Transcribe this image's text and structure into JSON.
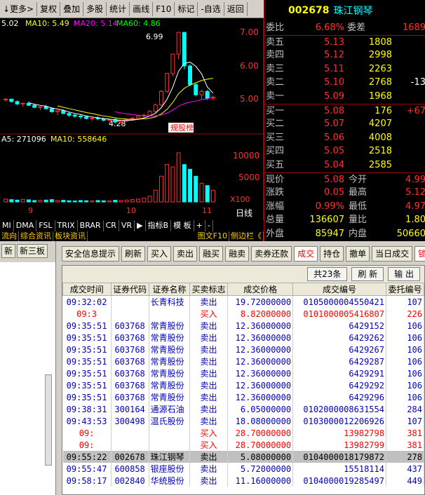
{
  "toolbar": {
    "items": [
      "↓更多>",
      "复权",
      "叠加",
      "多股",
      "统计",
      "画线",
      "F10",
      "标记",
      "-自选",
      "返回"
    ]
  },
  "quote_header": {
    "code": "002678",
    "name": "珠江钢琴"
  },
  "ma_legend": {
    "ma5": "5.02",
    "ma10": "MA10: 5.49",
    "ma20": "MA20: 5.14",
    "ma60": "MA60: 4.86"
  },
  "price_axis": [
    "7.00",
    "6.00",
    "5.00"
  ],
  "high_label": "6.99",
  "low_label": "4.28",
  "stock_tag": "规股榜",
  "vol_legend": {
    "ma5": "A5: 271096",
    "ma10": "MA10: 558646"
  },
  "vol_axis": [
    "10000",
    "5000",
    "X100"
  ],
  "date_labels": [
    "9",
    "10",
    "11"
  ],
  "period_label": "日线",
  "chart_data": {
    "type": "candlestick",
    "price_ylim": [
      4.1,
      7.2
    ],
    "ohlc": [
      [
        5.0,
        5.05,
        4.95,
        5.02
      ],
      [
        5.02,
        5.04,
        4.92,
        4.95
      ],
      [
        4.95,
        4.98,
        4.85,
        4.88
      ],
      [
        4.88,
        4.92,
        4.8,
        4.9
      ],
      [
        4.9,
        4.95,
        4.82,
        4.84
      ],
      [
        4.84,
        4.88,
        4.75,
        4.78
      ],
      [
        4.78,
        4.82,
        4.7,
        4.8
      ],
      [
        4.8,
        4.85,
        4.72,
        4.74
      ],
      [
        4.74,
        4.78,
        4.62,
        4.65
      ],
      [
        4.65,
        4.7,
        4.55,
        4.68
      ],
      [
        4.68,
        4.72,
        4.58,
        4.6
      ],
      [
        4.6,
        4.64,
        4.5,
        4.55
      ],
      [
        4.55,
        4.6,
        4.48,
        4.52
      ],
      [
        4.52,
        4.56,
        4.44,
        4.5
      ],
      [
        4.5,
        4.54,
        4.42,
        4.45
      ],
      [
        4.45,
        4.5,
        4.38,
        4.46
      ],
      [
        4.46,
        4.52,
        4.4,
        4.44
      ],
      [
        4.44,
        4.48,
        4.36,
        4.4
      ],
      [
        4.4,
        4.45,
        4.33,
        4.42
      ],
      [
        4.42,
        4.46,
        4.3,
        4.35
      ],
      [
        4.35,
        4.4,
        4.28,
        4.38
      ],
      [
        4.38,
        4.45,
        4.34,
        4.42
      ],
      [
        4.42,
        4.5,
        4.38,
        4.46
      ],
      [
        4.46,
        4.55,
        4.42,
        4.52
      ],
      [
        4.52,
        4.6,
        4.48,
        4.55
      ],
      [
        4.55,
        4.7,
        4.52,
        4.66
      ],
      [
        4.66,
        4.9,
        4.62,
        4.85
      ],
      [
        4.85,
        5.3,
        4.8,
        5.25
      ],
      [
        5.25,
        5.8,
        5.2,
        5.78
      ],
      [
        5.78,
        6.35,
        5.7,
        6.35
      ],
      [
        6.35,
        6.99,
        6.2,
        6.99
      ],
      [
        6.99,
        6.99,
        5.9,
        6.0
      ],
      [
        6.0,
        6.05,
        5.4,
        5.45
      ],
      [
        5.45,
        5.5,
        5.1,
        5.15
      ],
      [
        5.15,
        5.3,
        5.0,
        5.25
      ],
      [
        5.25,
        5.3,
        5.0,
        5.05
      ],
      [
        5.05,
        5.12,
        4.98,
        5.08
      ]
    ],
    "vol_ylim": [
      0,
      12000
    ],
    "volume": [
      600,
      500,
      400,
      550,
      450,
      300,
      350,
      400,
      500,
      300,
      350,
      250,
      200,
      300,
      250,
      200,
      300,
      250,
      200,
      350,
      300,
      400,
      500,
      600,
      800,
      1200,
      2500,
      5500,
      8000,
      7500,
      10500,
      8000,
      7000,
      5500,
      4000,
      3500,
      2500
    ]
  },
  "quote": {
    "weibi": {
      "label": "委比",
      "value": "6.68%",
      "label2": "委差",
      "value2": "1689"
    },
    "sells": [
      {
        "label": "卖五",
        "price": "5.13",
        "vol": "1808",
        "chg": ""
      },
      {
        "label": "卖四",
        "price": "5.12",
        "vol": "2998",
        "chg": ""
      },
      {
        "label": "卖三",
        "price": "5.11",
        "vol": "2263",
        "chg": ""
      },
      {
        "label": "卖二",
        "price": "5.10",
        "vol": "2768",
        "chg": "-13"
      },
      {
        "label": "卖一",
        "price": "5.09",
        "vol": "1968",
        "chg": ""
      }
    ],
    "buys": [
      {
        "label": "买一",
        "price": "5.08",
        "vol": "176",
        "chg": "+67"
      },
      {
        "label": "买二",
        "price": "5.07",
        "vol": "4207",
        "chg": ""
      },
      {
        "label": "买三",
        "price": "5.06",
        "vol": "4008",
        "chg": ""
      },
      {
        "label": "买四",
        "price": "5.05",
        "vol": "2518",
        "chg": ""
      },
      {
        "label": "买五",
        "price": "5.04",
        "vol": "2585",
        "chg": ""
      }
    ],
    "stats": [
      {
        "l1": "现价",
        "v1": "5.08",
        "l2": "今开",
        "v2": "4.99"
      },
      {
        "l1": "涨跌",
        "v1": "0.05",
        "l2": "最高",
        "v2": "5.12"
      },
      {
        "l1": "涨幅",
        "v1": "0.99%",
        "l2": "最低",
        "v2": "4.97"
      },
      {
        "l1": "总量",
        "v1": "136607",
        "l2": "量比",
        "v2": "1.80"
      },
      {
        "l1": "外盘",
        "v1": "85947",
        "l2": "内盘",
        "v2": "50660"
      }
    ]
  },
  "chart_tabs": [
    "MI",
    "DMA",
    "FSL",
    "TRIX",
    "BRAR",
    "CR",
    "VR",
    "▶",
    "指标B",
    "模 板",
    "+",
    "-"
  ],
  "info_tabs": [
    "流向",
    "综合资讯",
    "板块资讯",
    "图文F10",
    "侧边栏《"
  ],
  "left_buttons": [
    "新",
    "新三板"
  ],
  "trade_buttons": [
    "安全信息提示",
    "刷新",
    "买入",
    "卖出",
    "融买",
    "融卖",
    "卖券还款",
    "成交",
    "持仓",
    "撤单",
    "当日成交",
    "锁定"
  ],
  "grid_top": {
    "count": "共23条",
    "refresh": "刷 新",
    "export": "输 出"
  },
  "columns": [
    "成交时间",
    "证券代码",
    "证券名称",
    "买卖标志",
    "成交价格",
    "成交编号",
    "委托编号"
  ],
  "rows": [
    {
      "t": "09:32:02",
      "code": "",
      "name": "长青科技",
      "side": "卖出",
      "price": "19.72000000",
      "deal": "0105000004550421",
      "order": "107",
      "cls": "blue"
    },
    {
      "t": "09:3",
      "code": "",
      "name": "",
      "side": "买入",
      "price": "8.82000000",
      "deal": "0101000005416807",
      "order": "226",
      "cls": "redr"
    },
    {
      "t": "09:35:51",
      "code": "603768",
      "name": "常青股份",
      "side": "卖出",
      "price": "12.36000000",
      "deal": "6429152",
      "order": "106",
      "cls": "blue"
    },
    {
      "t": "09:35:51",
      "code": "603768",
      "name": "常青股份",
      "side": "卖出",
      "price": "12.36000000",
      "deal": "6429262",
      "order": "106",
      "cls": "blue"
    },
    {
      "t": "09:35:51",
      "code": "603768",
      "name": "常青股份",
      "side": "卖出",
      "price": "12.36000000",
      "deal": "6429267",
      "order": "106",
      "cls": "blue"
    },
    {
      "t": "09:35:51",
      "code": "603768",
      "name": "常青股份",
      "side": "卖出",
      "price": "12.36000000",
      "deal": "6429287",
      "order": "106",
      "cls": "blue"
    },
    {
      "t": "09:35:51",
      "code": "603768",
      "name": "常青股份",
      "side": "卖出",
      "price": "12.36000000",
      "deal": "6429291",
      "order": "106",
      "cls": "blue"
    },
    {
      "t": "09:35:51",
      "code": "603768",
      "name": "常青股份",
      "side": "卖出",
      "price": "12.36000000",
      "deal": "6429292",
      "order": "106",
      "cls": "blue"
    },
    {
      "t": "09:35:51",
      "code": "603768",
      "name": "常青股份",
      "side": "卖出",
      "price": "12.36000000",
      "deal": "6429296",
      "order": "106",
      "cls": "blue"
    },
    {
      "t": "09:38:31",
      "code": "300164",
      "name": "通源石油",
      "side": "卖出",
      "price": "6.05000000",
      "deal": "0102000008631554",
      "order": "284",
      "cls": "blue"
    },
    {
      "t": "09:43:53",
      "code": "300498",
      "name": "温氏股份",
      "side": "卖出",
      "price": "18.08000000",
      "deal": "0103000012206926",
      "order": "107",
      "cls": "blue"
    },
    {
      "t": "09:",
      "code": "",
      "name": "",
      "side": "买入",
      "price": "28.70000000",
      "deal": "13982798",
      "order": "381",
      "cls": "redr"
    },
    {
      "t": "09:",
      "code": "",
      "name": "",
      "side": "买入",
      "price": "28.70000000",
      "deal": "13982799",
      "order": "381",
      "cls": "redr"
    },
    {
      "t": "09:55:22",
      "code": "002678",
      "name": "珠江钢琴",
      "side": "卖出",
      "price": "5.08000000",
      "deal": "0104000018179872",
      "order": "278",
      "cls": "sel"
    },
    {
      "t": "09:55:47",
      "code": "600858",
      "name": "银座股份",
      "side": "卖出",
      "price": "5.72000000",
      "deal": "15518114",
      "order": "437",
      "cls": "blue"
    },
    {
      "t": "09:58:17",
      "code": "002840",
      "name": "华统股份",
      "side": "卖出",
      "price": "11.16000000",
      "deal": "0104000019285497",
      "order": "449",
      "cls": "blue"
    }
  ]
}
